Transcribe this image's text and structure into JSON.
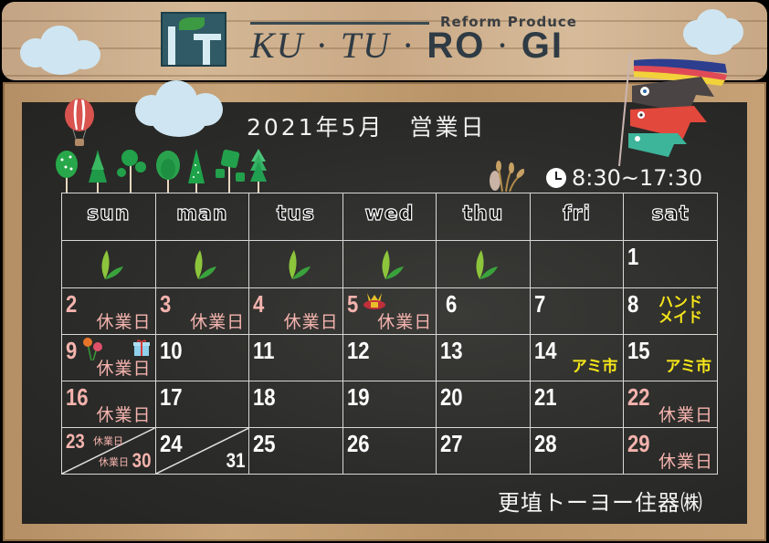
{
  "header": {
    "logo_alt": "K·T logo",
    "tagline": "Reform Produce",
    "brand_parts": [
      "KU",
      "TU",
      "RO",
      "GI"
    ],
    "separator": "·"
  },
  "board": {
    "title": "2021年5月　営業日",
    "hours_icon": "clock-icon",
    "hours": "8:30~17:30",
    "company": "更埴トーヨー住器㈱"
  },
  "calendar": {
    "weekdays": [
      "sun",
      "man",
      "tus",
      "wed",
      "thu",
      "fri",
      "sat"
    ],
    "closed_label": "休業日",
    "colors": {
      "holiday": "#f4b3ad",
      "event": "#f5e51a",
      "normal": "#ffffff"
    },
    "rows": [
      [
        {
          "icon": "leaf-icon"
        },
        {
          "icon": "leaf-icon"
        },
        {
          "icon": "leaf-icon"
        },
        {
          "icon": "leaf-icon"
        },
        {
          "icon": "leaf-icon"
        },
        {},
        {
          "day": "1"
        }
      ],
      [
        {
          "day": "2",
          "closed": true
        },
        {
          "day": "3",
          "closed": true
        },
        {
          "day": "4",
          "closed": true
        },
        {
          "day": "5",
          "closed": true,
          "icon": "kabuto-helmet-icon"
        },
        {
          "day": "6"
        },
        {
          "day": "7"
        },
        {
          "day": "8",
          "event": "ハンド メイド"
        }
      ],
      [
        {
          "day": "9",
          "closed": true,
          "icon": "carnation-icon"
        },
        {
          "day": "10"
        },
        {
          "day": "11"
        },
        {
          "day": "12"
        },
        {
          "day": "13"
        },
        {
          "day": "14",
          "event": "アミ市"
        },
        {
          "day": "15",
          "event": "アミ市"
        }
      ],
      [
        {
          "day": "16",
          "closed": true
        },
        {
          "day": "17"
        },
        {
          "day": "18"
        },
        {
          "day": "19"
        },
        {
          "day": "20"
        },
        {
          "day": "21"
        },
        {
          "day": "22",
          "closed": true
        }
      ],
      [
        {
          "day": "23",
          "day2": "30",
          "closed": true,
          "closed2": true
        },
        {
          "day": "24",
          "day2": "31"
        },
        {
          "day": "25"
        },
        {
          "day": "26"
        },
        {
          "day": "27"
        },
        {
          "day": "28"
        },
        {
          "day": "29",
          "closed": true
        }
      ]
    ]
  },
  "labels": {
    "event_8_line1": "ハンド",
    "event_8_line2": "メイド",
    "event_market": "アミ市"
  }
}
